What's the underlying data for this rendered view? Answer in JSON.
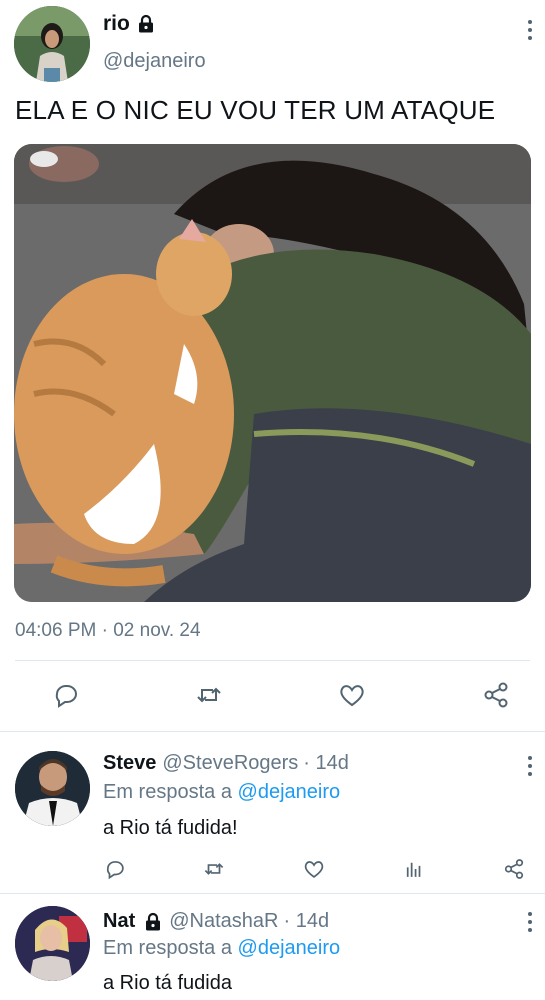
{
  "main_tweet": {
    "name": "rio",
    "handle": "@dejaneiro",
    "text": "ELA E O NIC EU VOU TER UM ATAQUE",
    "timestamp": "04:06 PM · 02 nov. 24",
    "protected": true,
    "photo_description_icon": "photo-image"
  },
  "actions": {
    "reply_icon": "reply-icon",
    "retweet_icon": "retweet-icon",
    "like_icon": "heart-icon",
    "share_icon": "share-icon"
  },
  "replies": [
    {
      "name": "Steve",
      "handle": "@SteveRogers",
      "time": "· 14d",
      "reply_to_prefix": "Em resposta a",
      "reply_to_mention": "@dejaneiro",
      "text": "a Rio tá fudida!",
      "protected": false
    },
    {
      "name": "Nat",
      "handle": "@NatashaR",
      "time": "· 14d",
      "reply_to_prefix": "Em resposta a",
      "reply_to_mention": "@dejaneiro",
      "text": "a Rio tá fudida",
      "protected": true
    }
  ],
  "colors": {
    "text_primary": "#0f1419",
    "text_secondary": "#657786",
    "link": "#1d9bf0",
    "divider": "#e1e8ed",
    "icon": "#536471"
  }
}
